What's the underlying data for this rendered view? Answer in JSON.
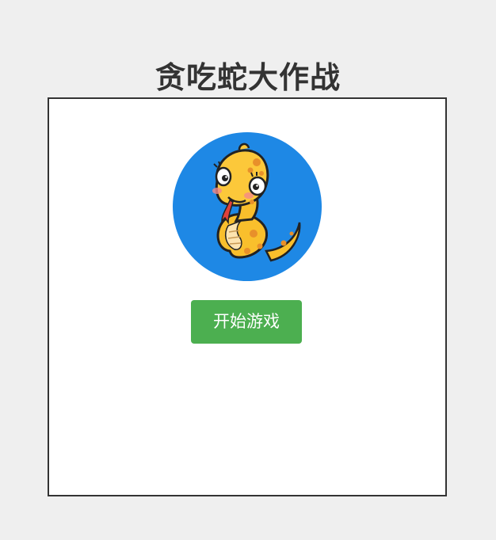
{
  "header": {
    "title": "贪吃蛇大作战"
  },
  "start_screen": {
    "logo_icon": "cartoon-snake-icon",
    "start_button_label": "开始游戏"
  },
  "colors": {
    "page_background": "#efefef",
    "board_background": "#ffffff",
    "board_border": "#333333",
    "title_text": "#333333",
    "logo_circle": "#1e88e5",
    "snake_body": "#f9bf2c",
    "snake_spots": "#e8902a",
    "start_button": "#4caf50",
    "start_button_text": "#ffffff"
  }
}
